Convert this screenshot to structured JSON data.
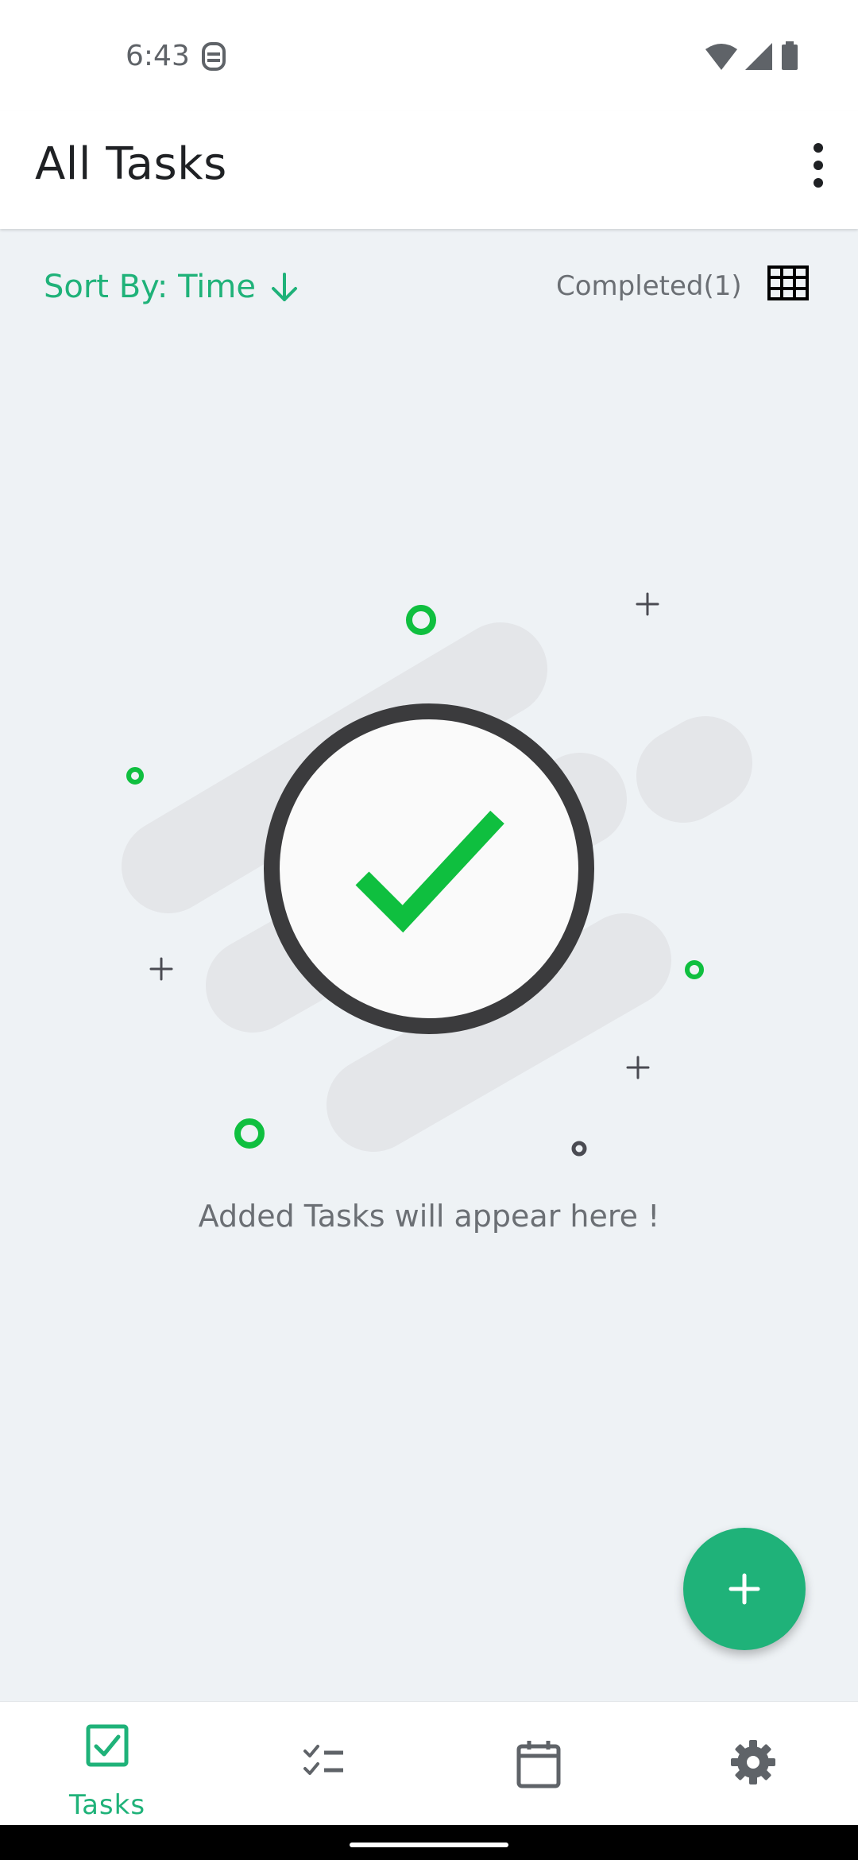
{
  "status_bar": {
    "time": "6:43"
  },
  "app_bar": {
    "title": "All Tasks"
  },
  "toolbar": {
    "sort_label": "Sort By: Time",
    "completed_label": "Completed(1)"
  },
  "empty_state": {
    "message": "Added Tasks will appear here !"
  },
  "bottom_nav": {
    "items": [
      {
        "label": "Tasks",
        "icon": "tasks-checkbox-icon",
        "selected": true
      },
      {
        "label": "",
        "icon": "checklist-icon",
        "selected": false
      },
      {
        "label": "",
        "icon": "calendar-icon",
        "selected": false
      },
      {
        "label": "",
        "icon": "settings-gear-icon",
        "selected": false
      }
    ]
  },
  "colors": {
    "accent": "#1fb279",
    "check_green": "#0fbf3f",
    "background": "#eef2f5",
    "ring": "#3b3b3d"
  }
}
